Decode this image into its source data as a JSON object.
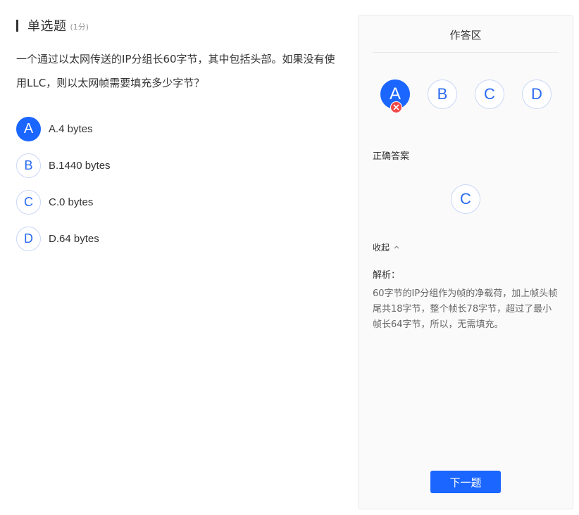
{
  "question": {
    "type_label": "单选题",
    "score": "(1分)",
    "text": "一个通过以太网传送的IP分组长60字节，其中包括头部。如果没有使用LLC，则以太网帧需要填充多少字节？",
    "options": [
      {
        "letter": "A",
        "text": "A.4 bytes",
        "selected": true
      },
      {
        "letter": "B",
        "text": "B.1440 bytes",
        "selected": false
      },
      {
        "letter": "C",
        "text": "C.0 bytes",
        "selected": false
      },
      {
        "letter": "D",
        "text": "D.64 bytes",
        "selected": false
      }
    ]
  },
  "panel": {
    "title": "作答区",
    "answer_choices": [
      "A",
      "B",
      "C",
      "D"
    ],
    "chosen": "A",
    "chosen_status_icon": "wrong-x-icon",
    "correct_label": "正确答案",
    "correct_answer": "C",
    "collapse_label": "收起",
    "collapse_icon": "chevron-up-icon",
    "analysis_label": "解析：",
    "analysis_text": "60字节的IP分组作为帧的净载荷，加上帧头帧尾共18字节，整个帧长78字节，超过了最小帧长64字节，所以，无需填充。",
    "next_button": "下一题"
  },
  "colors": {
    "accent": "#1a66ff",
    "wrong": "#f04848",
    "panel_bg": "#fafafa"
  }
}
